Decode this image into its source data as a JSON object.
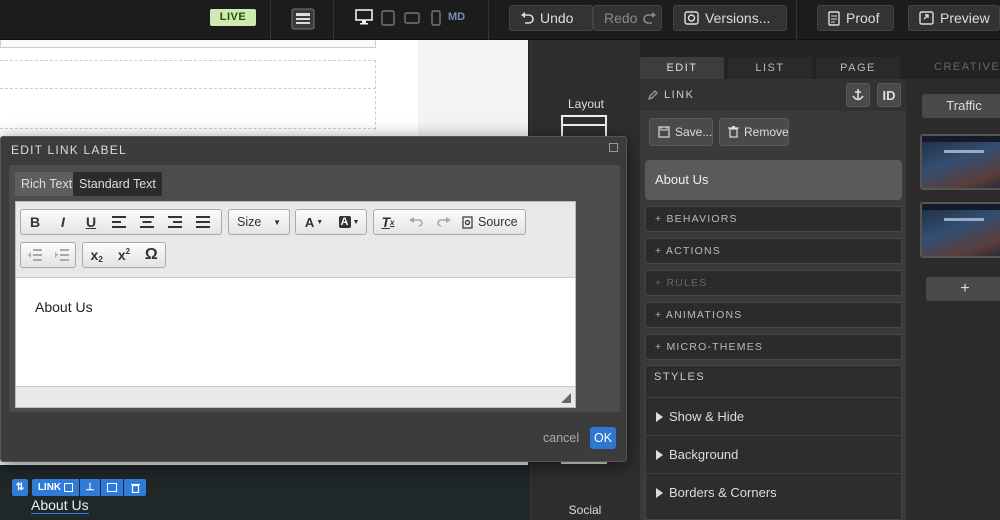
{
  "topbar": {
    "live_label": "LIVE",
    "breakpoint_label": "MD",
    "undo_label": "Undo",
    "redo_label": "Redo",
    "versions_label": "Versions...",
    "proof_label": "Proof",
    "preview_label": "Preview"
  },
  "panel": {
    "tabs": [
      {
        "label": "EDIT"
      },
      {
        "label": "LIST"
      },
      {
        "label": "PAGE"
      }
    ],
    "creative_tab": "CREATIVE",
    "section_title": "LINK",
    "id_label": "ID",
    "save_label": "Save...",
    "remove_label": "Remove",
    "link_value": "About Us",
    "accordions": [
      {
        "label": "+ BEHAVIORS"
      },
      {
        "label": "+ ACTIONS"
      },
      {
        "label": "+ RULES"
      },
      {
        "label": "+ ANIMATIONS"
      },
      {
        "label": "+ MICRO-THEMES"
      }
    ],
    "styles_title": "STYLES",
    "styles": [
      {
        "label": "Show & Hide"
      },
      {
        "label": "Background"
      },
      {
        "label": "Borders & Corners"
      }
    ]
  },
  "tools": {
    "layout_label": "Layout",
    "social_label": "Social"
  },
  "right": {
    "traffic_label": "Traffic",
    "add_label": "+"
  },
  "modal": {
    "title": "EDIT LINK LABEL",
    "tab_rich": "Rich Text",
    "tab_standard": "Standard Text",
    "size_label": "Size",
    "source_label": "Source",
    "content": "About Us",
    "cancel_label": "cancel",
    "ok_label": "OK"
  },
  "link_widget": {
    "tag_label": "LINK",
    "text": "About Us"
  },
  "colors": {
    "accent_blue": "#2e78d2",
    "live_badge": "#cdeab0"
  }
}
